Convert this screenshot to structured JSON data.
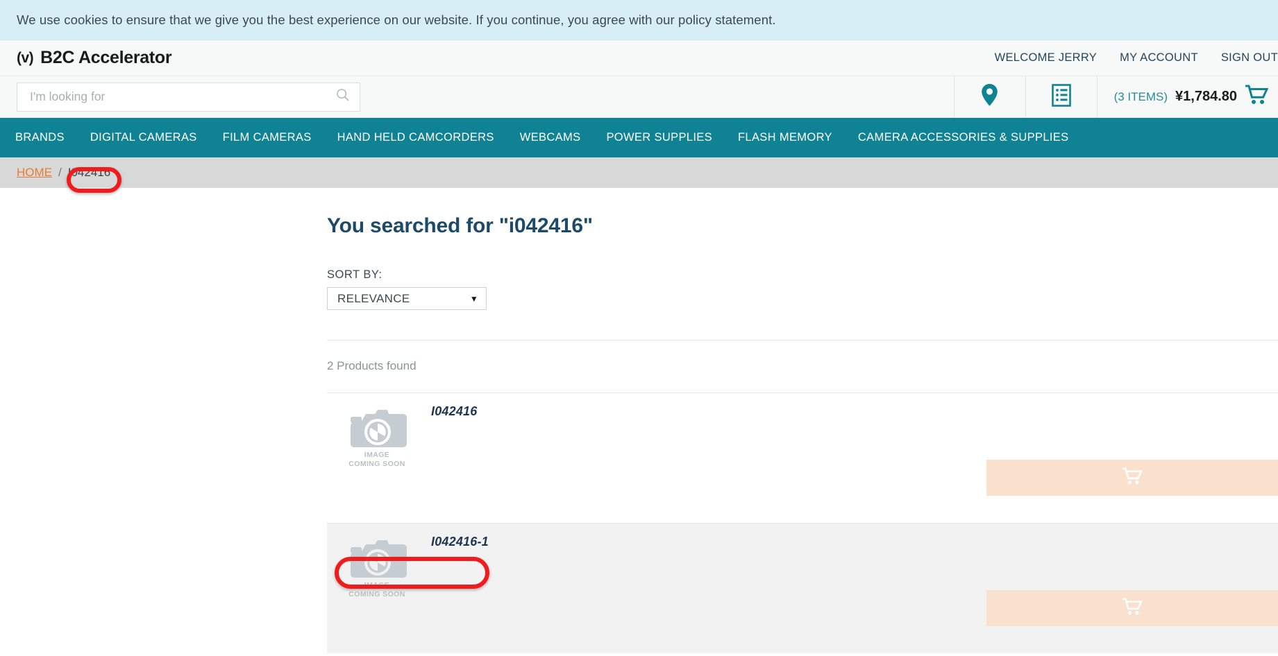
{
  "cookie": {
    "message": "We use cookies to ensure that we give you the best experience on our website. If you continue, you agree with our policy statement."
  },
  "header": {
    "brand_mark": "(v)",
    "brand_name": "B2C Accelerator",
    "links": [
      "WELCOME JERRY",
      "MY ACCOUNT",
      "SIGN OUT"
    ]
  },
  "search": {
    "placeholder": "I'm looking for",
    "value": "",
    "search_icon": "search-icon"
  },
  "toolbar": {
    "location_icon": "location-pin-icon",
    "list_icon": "order-list-icon",
    "cart_items": "(3 ITEMS)",
    "cart_total": "¥1,784.80",
    "cart_icon": "shopping-cart-icon"
  },
  "nav": {
    "items": [
      "BRANDS",
      "DIGITAL CAMERAS",
      "FILM CAMERAS",
      "HAND HELD CAMCORDERS",
      "WEBCAMS",
      "POWER SUPPLIES",
      "FLASH MEMORY",
      "CAMERA ACCESSORIES & SUPPLIES"
    ]
  },
  "breadcrumb": {
    "home": "HOME",
    "separator": "/",
    "current": "I042416"
  },
  "main": {
    "title": "You searched for \"i042416\"",
    "sort_label": "SORT BY:",
    "sort_value": "RELEVANCE",
    "sort_caret": "▼",
    "results_count": "2 Products found",
    "placeholder_line1": "IMAGE",
    "placeholder_line2": "COMING SOON",
    "products": [
      {
        "title": "I042416"
      },
      {
        "title": "I042416-1"
      }
    ]
  },
  "colors": {
    "teal": "#0f8293",
    "orange": "#e87b35",
    "navy": "#1d4a69",
    "cookie_bg": "#d7eef7",
    "peach": "#fae1ce",
    "annotation_red": "#ee1c1c"
  }
}
